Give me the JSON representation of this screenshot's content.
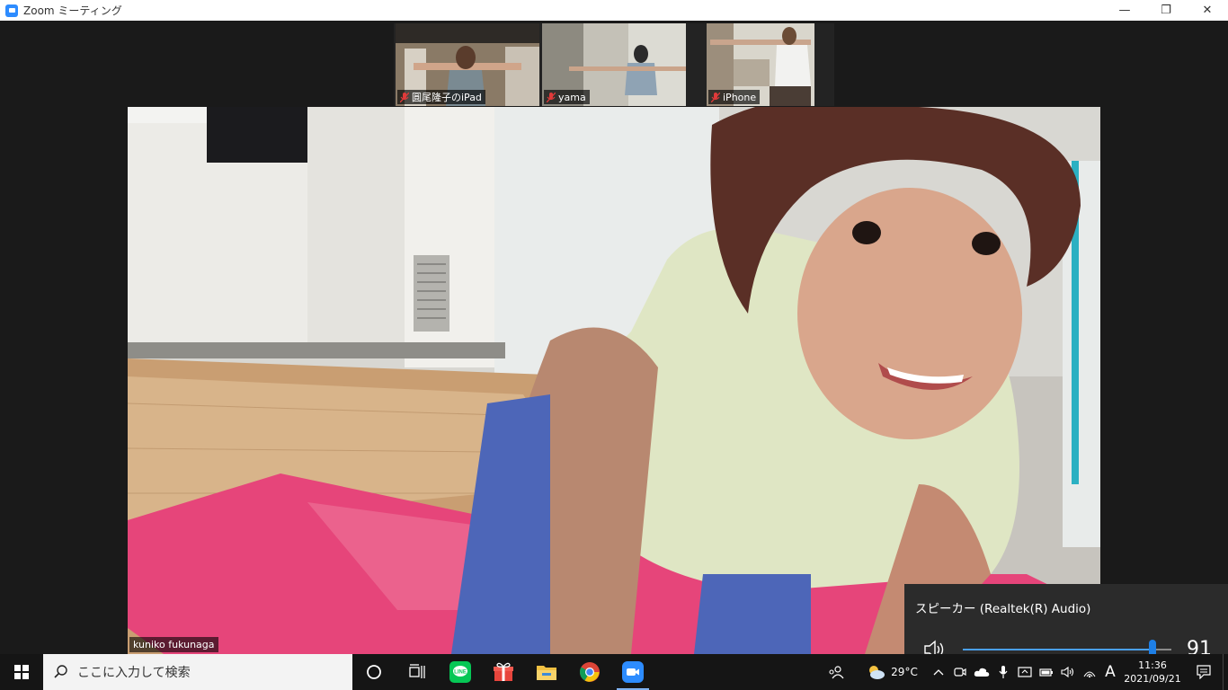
{
  "window": {
    "title": "Zoom ミーティング",
    "controls": {
      "minimize": "—",
      "restore": "❐",
      "close": "✕"
    }
  },
  "participants": [
    {
      "name": "圓尾隆子のiPad",
      "muted": true
    },
    {
      "name": "yama",
      "muted": true
    },
    {
      "name": "iPhone",
      "muted": true
    }
  ],
  "active_speaker": {
    "name": "kuniko fukunaga"
  },
  "volume": {
    "device": "スピーカー (Realtek(R) Audio)",
    "level": 91
  },
  "taskbar": {
    "search_placeholder": "ここに入力して検索",
    "apps": [
      "cortana-icon",
      "task-view-icon",
      "line-icon",
      "gift-icon",
      "file-explorer-icon",
      "chrome-icon",
      "zoom-icon"
    ],
    "weather": {
      "temp": "29°C"
    },
    "ime": "A",
    "clock": {
      "time": "11:36",
      "date": "2021/09/21"
    }
  },
  "colors": {
    "zoom_blue": "#2d8cff",
    "line_green": "#06c755",
    "slider_blue": "#1e7fe6"
  }
}
